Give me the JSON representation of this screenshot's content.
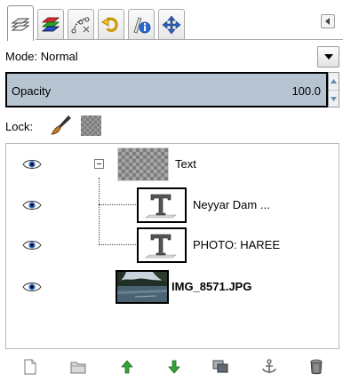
{
  "tabs": [
    {
      "icon": "layers-icon",
      "active": true
    },
    {
      "icon": "channels-icon",
      "active": false
    },
    {
      "icon": "paths-icon",
      "active": false
    },
    {
      "icon": "undo-history-icon",
      "active": false
    },
    {
      "icon": "pointer-info-icon",
      "active": false
    },
    {
      "icon": "move-icon",
      "active": false
    }
  ],
  "tab_menu_icon": "tab-menu-icon",
  "mode": {
    "label": "Mode: Normal"
  },
  "opacity": {
    "label": "Opacity",
    "value": "100.0"
  },
  "lock": {
    "label": "Lock:",
    "icons": [
      "paint-brush-icon",
      "alpha-checker-icon"
    ]
  },
  "layers": [
    {
      "name": "Text",
      "type": "group",
      "visible": true
    },
    {
      "name": "Neyyar Dam ...",
      "type": "text",
      "visible": true
    },
    {
      "name": "PHOTO: HAREE",
      "type": "text",
      "visible": true
    },
    {
      "name": "IMG_8571.JPG",
      "type": "image",
      "visible": true
    }
  ],
  "bottom_toolbar": [
    "new-layer-icon",
    "new-layer-group-icon",
    "raise-layer-icon",
    "lower-layer-icon",
    "duplicate-layer-icon",
    "anchor-layer-icon",
    "delete-layer-icon"
  ],
  "colors": {
    "opacity_fill": "#b6c4d2",
    "raise_lower_green": "#3aa13a"
  }
}
